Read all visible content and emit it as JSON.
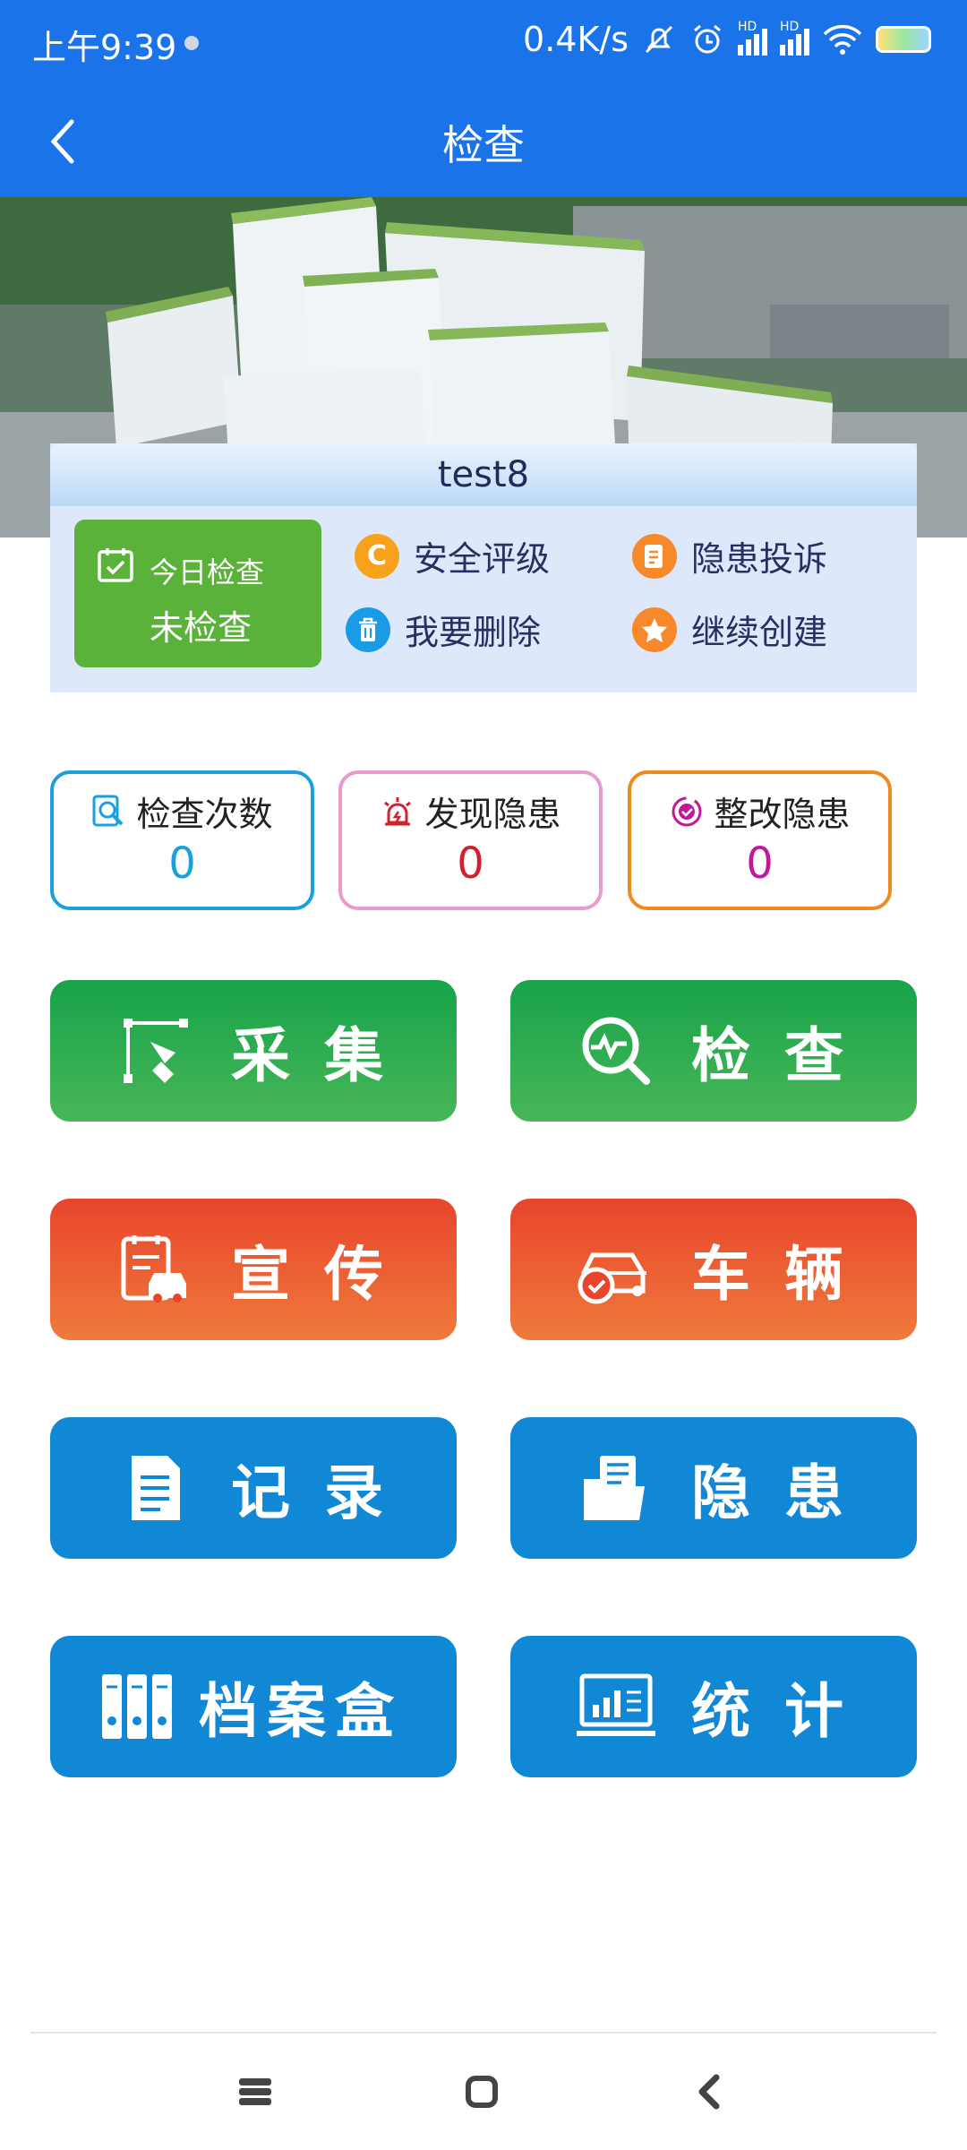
{
  "status_bar": {
    "time": "上午9:39",
    "network_speed": "0.4K/s",
    "signal_label_1": "HD",
    "signal_label_2": "HD"
  },
  "app_bar": {
    "title": "检查",
    "back_icon": "chevron-left-icon"
  },
  "banner": {
    "image": "aerial view of modern building complex with green rooftops"
  },
  "site_card": {
    "name": "test8",
    "today_label": "今日检查",
    "today_value": "未检查",
    "actions": [
      {
        "label": "安全评级",
        "icon": "c-rating-icon",
        "color": "#f7a21a"
      },
      {
        "label": "隐患投诉",
        "icon": "document-edit-icon",
        "color": "#f7892a"
      },
      {
        "label": "我要删除",
        "icon": "trash-icon",
        "color": "#1b9be6"
      },
      {
        "label": "继续创建",
        "icon": "star-icon",
        "color": "#f7892a"
      }
    ]
  },
  "stats": [
    {
      "label": "检查次数",
      "value": "0",
      "color": "#1aa0e0",
      "icon": "search-document-icon"
    },
    {
      "label": "发现隐患",
      "value": "0",
      "color": "#e89ccd",
      "value_color": "#d0212c",
      "icon": "alarm-light-icon"
    },
    {
      "label": "整改隐患",
      "value": "0",
      "color": "#ef8a1f",
      "value_color": "#c2189c",
      "icon": "check-cycle-icon"
    }
  ],
  "menu": [
    {
      "label": "采集",
      "icon": "pen-tool-icon"
    },
    {
      "label": "检查",
      "icon": "search-pulse-icon"
    },
    {
      "label": "宣传",
      "icon": "clipboard-car-icon"
    },
    {
      "label": "车辆",
      "icon": "car-check-icon"
    },
    {
      "label": "记录",
      "icon": "document-icon"
    },
    {
      "label": "隐患",
      "icon": "folder-icon"
    },
    {
      "label": "档案盒",
      "icon": "binders-icon"
    },
    {
      "label": "统计",
      "icon": "monitor-chart-icon"
    }
  ],
  "colors": {
    "primary": "#1a73e8",
    "green_button": "#28a745",
    "orange_button": "#eb5a33",
    "blue_button": "#1188d6",
    "today_green": "#5ab23a"
  }
}
